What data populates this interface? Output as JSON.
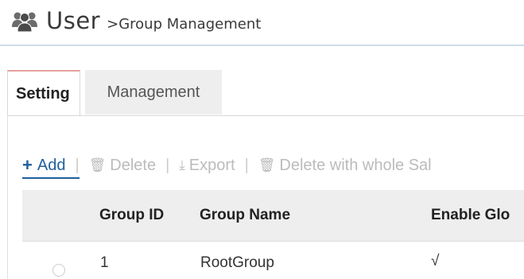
{
  "header": {
    "icon": "users-icon",
    "title": "User",
    "subtitle": ">Group Management"
  },
  "tabs": [
    {
      "label": "Setting",
      "active": true
    },
    {
      "label": "Management",
      "active": false
    }
  ],
  "toolbar": {
    "add_label": "Add",
    "delete_label": "Delete",
    "export_label": "Export",
    "delete_whole_label": "Delete with whole Sal",
    "separator": "|"
  },
  "table": {
    "columns": [
      "Group ID",
      "Group Name",
      "Enable Glo"
    ],
    "rows": [
      {
        "selected": false,
        "group_id": "1",
        "group_name": "RootGroup",
        "enable": "√"
      }
    ]
  },
  "colors": {
    "accent": "#1f5f9a",
    "active_tab_top": "#e8a0a0",
    "header_rule": "#cfdde6",
    "table_header_bg": "#eeeeee",
    "disabled_text": "#bbbbbb"
  }
}
